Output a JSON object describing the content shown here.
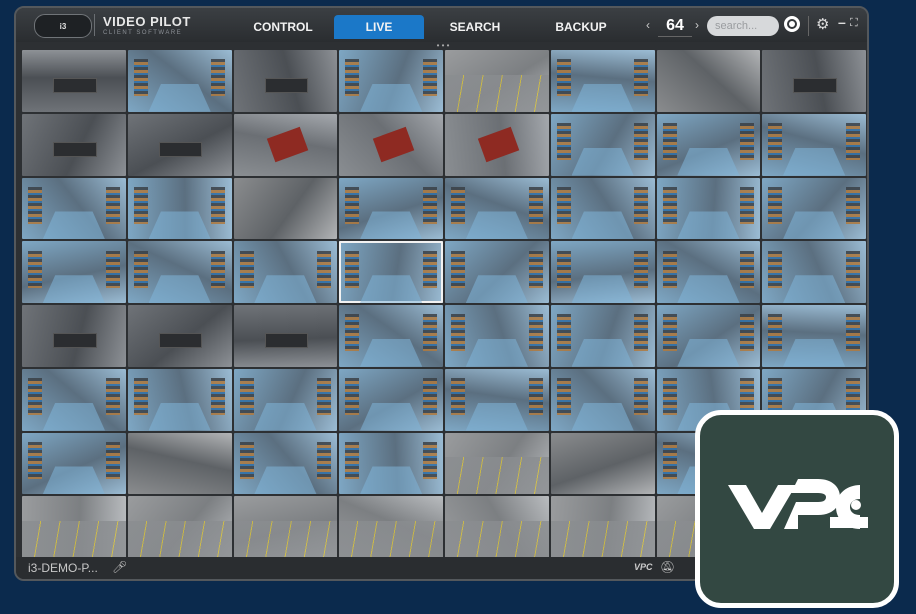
{
  "header": {
    "logo_badge_text": "i3",
    "brand_title": "VIDEO PILOT",
    "brand_subtitle": "CLIENT SOFTWARE",
    "tabs": [
      {
        "label": "CONTROL",
        "active": false
      },
      {
        "label": "LIVE",
        "active": true
      },
      {
        "label": "SEARCH",
        "active": false
      },
      {
        "label": "BACKUP",
        "active": false
      }
    ],
    "pager": {
      "prev": "‹",
      "value": "64",
      "next": "›"
    },
    "search_placeholder": "search...",
    "icons": [
      "target-icon",
      "gear-icon",
      "minimize-icon",
      "fullscreen-icon"
    ]
  },
  "camera_grid": {
    "columns": 8,
    "rows": 8,
    "tile_count": 64,
    "selected_tile_index": 27,
    "scene_types": [
      "office",
      "warehouse",
      "office",
      "warehouse",
      "parking",
      "warehouse",
      "hallway",
      "office",
      "office",
      "office",
      "meeting",
      "meeting",
      "meeting",
      "warehouse",
      "warehouse",
      "warehouse",
      "warehouse",
      "warehouse",
      "hallway",
      "warehouse",
      "warehouse",
      "warehouse",
      "warehouse",
      "warehouse",
      "warehouse",
      "warehouse",
      "warehouse",
      "warehouse",
      "warehouse",
      "warehouse",
      "warehouse",
      "warehouse",
      "office",
      "office",
      "office",
      "warehouse",
      "warehouse",
      "warehouse",
      "warehouse",
      "warehouse",
      "warehouse",
      "warehouse",
      "warehouse",
      "warehouse",
      "warehouse",
      "warehouse",
      "warehouse",
      "warehouse",
      "warehouse",
      "hallway",
      "warehouse",
      "warehouse",
      "parking",
      "hallway",
      "warehouse",
      "warehouse",
      "parking",
      "parking",
      "parking",
      "parking",
      "parking",
      "parking",
      "parking",
      "parking"
    ]
  },
  "statusbar": {
    "site_name": "i3-DEMO-P...",
    "mini_logo": "VPC"
  },
  "overlay": {
    "badge_text": "VPC",
    "colors": {
      "background": "#334842",
      "border": "#ffffff",
      "mark": "#ffffff"
    }
  },
  "colors": {
    "page_background": "#0b2a4d",
    "window_background": "#2d3033",
    "active_tab": "#1b78c8"
  }
}
